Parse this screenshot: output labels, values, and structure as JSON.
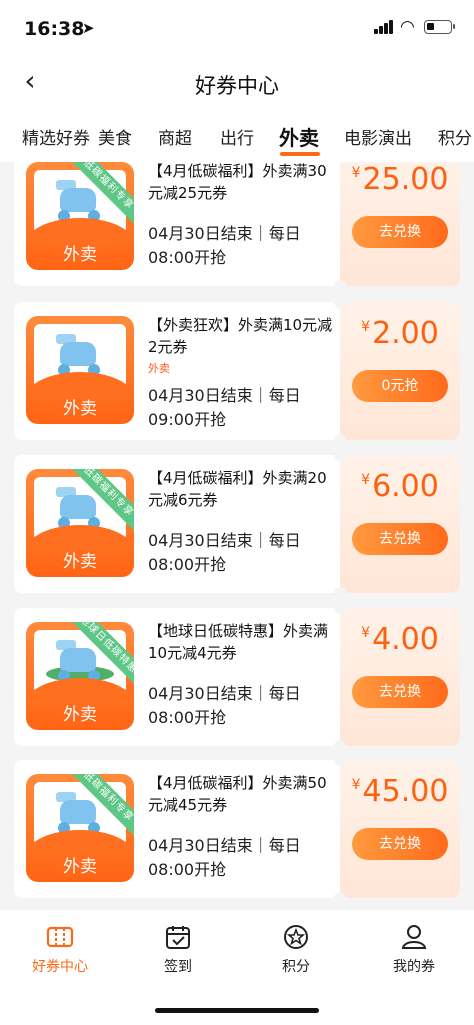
{
  "status": {
    "time": "16:38"
  },
  "nav": {
    "title": "好券中心"
  },
  "tabs": [
    "精选好券",
    "美食",
    "商超",
    "出行",
    "外卖",
    "电影演出",
    "积分"
  ],
  "active_tab": "外卖",
  "coupons": [
    {
      "title": "【4月低碳福利】外卖满30元减25元券",
      "tag": "",
      "meta": "04月30日结束｜每日08:00开抢",
      "yen": "¥",
      "price": "25.00",
      "button": "去兑换",
      "ribbon": "低碳福利专享",
      "art": "ribbon"
    },
    {
      "title": "【外卖狂欢】外卖满10元减2元券",
      "tag": "外卖",
      "meta": "04月30日结束｜每日09:00开抢",
      "yen": "¥",
      "price": "2.00",
      "button": "0元抢",
      "ribbon": "",
      "art": "plain"
    },
    {
      "title": "【4月低碳福利】外卖满20元减6元券",
      "tag": "",
      "meta": "04月30日结束｜每日08:00开抢",
      "yen": "¥",
      "price": "6.00",
      "button": "去兑换",
      "ribbon": "低碳福利专享",
      "art": "ribbon"
    },
    {
      "title": "【地球日低碳特惠】外卖满10元减4元券",
      "tag": "",
      "meta": "04月30日结束｜每日08:00开抢",
      "yen": "¥",
      "price": "4.00",
      "button": "去兑换",
      "ribbon": "地球日低碳特惠",
      "art": "earth"
    },
    {
      "title": "【4月低碳福利】外卖满50元减45元券",
      "tag": "",
      "meta": "04月30日结束｜每日08:00开抢",
      "yen": "¥",
      "price": "45.00",
      "button": "去兑换",
      "ribbon": "低碳福利专享",
      "art": "ribbon"
    }
  ],
  "thumb_label": "外卖",
  "bottom_nav": [
    {
      "label": "好券中心",
      "icon": "ticket-icon",
      "active": true
    },
    {
      "label": "签到",
      "icon": "calendar-check-icon",
      "active": false
    },
    {
      "label": "积分",
      "icon": "star-circle-icon",
      "active": false
    },
    {
      "label": "我的券",
      "icon": "user-icon",
      "active": false
    }
  ],
  "colors": {
    "accent": "#ff6a1a",
    "ribbon": "#5fc786"
  }
}
